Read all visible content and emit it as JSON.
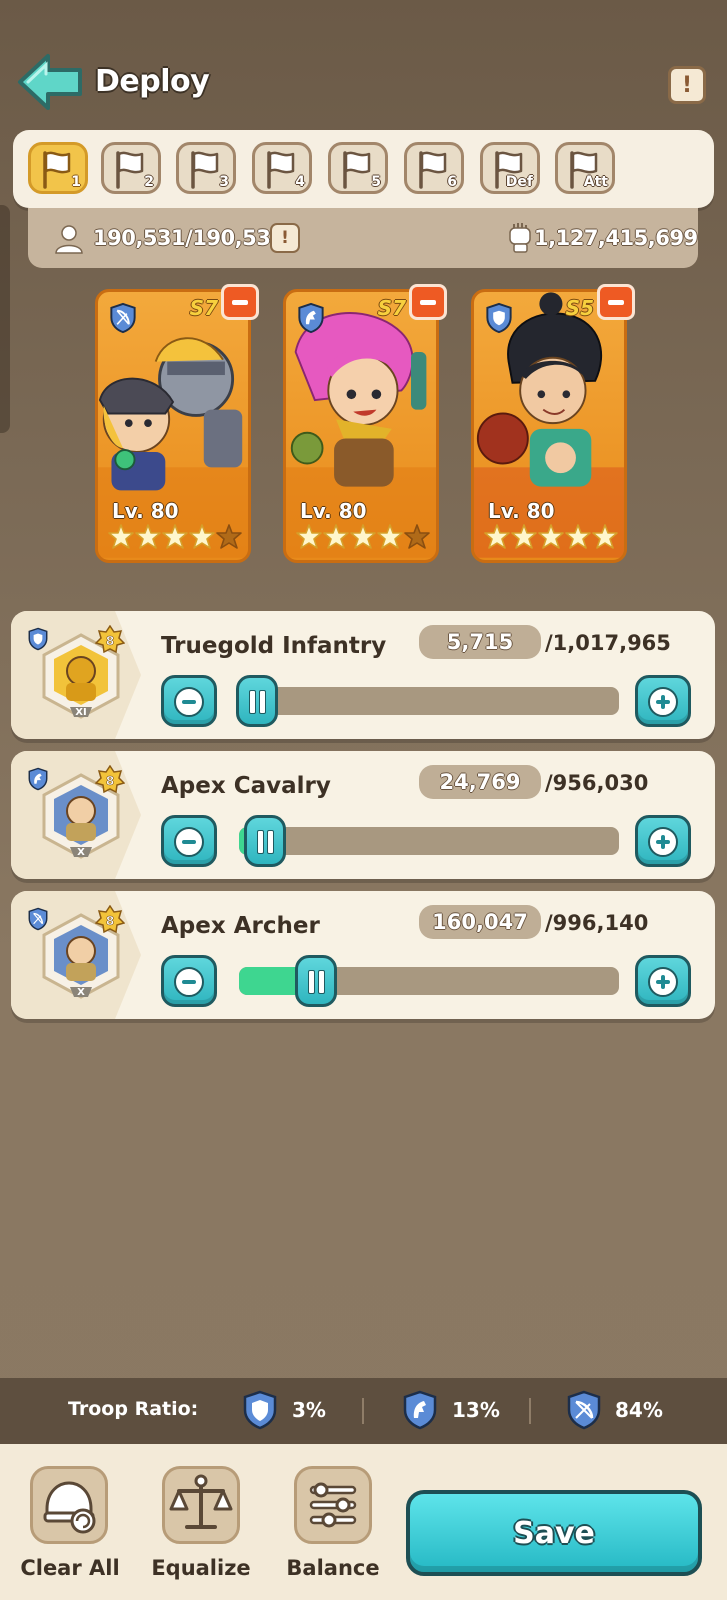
{
  "header": {
    "title": "Deploy"
  },
  "tabs": [
    {
      "label": "1",
      "active": true
    },
    {
      "label": "2",
      "active": false
    },
    {
      "label": "3",
      "active": false
    },
    {
      "label": "4",
      "active": false
    },
    {
      "label": "5",
      "active": false
    },
    {
      "label": "6",
      "active": false
    },
    {
      "label": "Def",
      "active": false
    },
    {
      "label": "Att",
      "active": false
    }
  ],
  "stats": {
    "capacity": "190,531/190,531",
    "power": "1,127,415,699"
  },
  "heroes": [
    {
      "season": "S7",
      "level": "Lv. 80",
      "class_icon": "archer-class-icon",
      "stars": 4,
      "accent": "#f3a93c"
    },
    {
      "season": "S7",
      "level": "Lv. 80",
      "class_icon": "cavalry-class-icon",
      "stars": 4,
      "accent": "#f3a93c"
    },
    {
      "season": "S5",
      "level": "Lv. 80",
      "class_icon": "infantry-class-icon",
      "stars": 5,
      "accent": "#f3a93c"
    }
  ],
  "troops": [
    {
      "name": "Truegold Infantry",
      "count": "5,715",
      "total": "/1,017,965",
      "tier": "XI",
      "badge": "8",
      "fill": 0.006,
      "class_icon": "infantry-class-icon"
    },
    {
      "name": "Apex Cavalry",
      "count": "24,769",
      "total": "/956,030",
      "tier": "X",
      "badge": "8",
      "fill": 0.026,
      "class_icon": "cavalry-class-icon"
    },
    {
      "name": "Apex Archer",
      "count": "160,047",
      "total": "/996,140",
      "tier": "X",
      "badge": "8",
      "fill": 0.161,
      "class_icon": "archer-class-icon"
    }
  ],
  "ratio": {
    "label": "Troop Ratio:",
    "infantry": "3%",
    "cavalry": "13%",
    "archer": "84%"
  },
  "toolbar": {
    "clear_label": "Clear All",
    "equalize_label": "Equalize",
    "balance_label": "Balance",
    "save_label": "Save"
  },
  "colors": {
    "accent": "#2fb5bf",
    "fill": "#3ed690",
    "remove": "#ee5a23"
  }
}
